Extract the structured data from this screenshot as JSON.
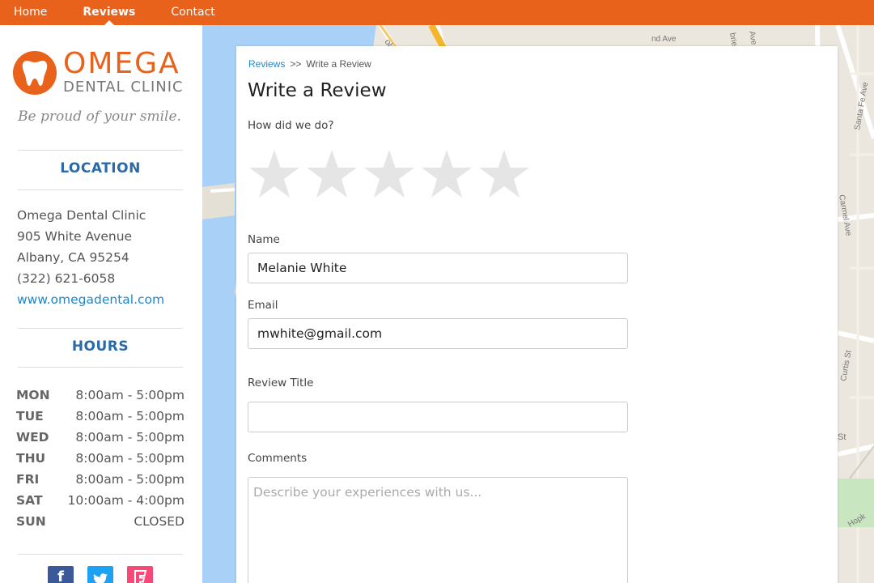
{
  "nav": {
    "items": [
      {
        "label": "Home",
        "active": false
      },
      {
        "label": "Reviews",
        "active": true
      },
      {
        "label": "Contact",
        "active": false
      }
    ]
  },
  "brand": {
    "name": "OMEGA",
    "subname": "DENTAL CLINIC",
    "tagline": "Be proud of your smile.",
    "accent_color": "#e8621c"
  },
  "location": {
    "title": "LOCATION",
    "name": "Omega Dental Clinic",
    "street": "905 White Avenue",
    "city": "Albany, CA 95254",
    "phone": "(322) 621-6058",
    "website": "www.omegadental.com"
  },
  "hours": {
    "title": "HOURS",
    "rows": [
      {
        "day": "MON",
        "time": "8:00am - 5:00pm"
      },
      {
        "day": "TUE",
        "time": "8:00am - 5:00pm"
      },
      {
        "day": "WED",
        "time": "8:00am - 5:00pm"
      },
      {
        "day": "THU",
        "time": "8:00am - 5:00pm"
      },
      {
        "day": "FRI",
        "time": "8:00am - 5:00pm"
      },
      {
        "day": "SAT",
        "time": "10:00am - 4:00pm"
      },
      {
        "day": "SUN",
        "time": "CLOSED"
      }
    ]
  },
  "social": [
    {
      "icon": "facebook-icon",
      "glyph": "f",
      "color": "#3b5998"
    },
    {
      "icon": "twitter-icon",
      "glyph": "t",
      "color": "#1da1f2"
    },
    {
      "icon": "foursquare-icon",
      "glyph": "F",
      "color": "#f94877"
    }
  ],
  "map": {
    "streets": [
      "Gilbert St",
      "Santa Fe Ave",
      "Carmel Ave",
      "Curtis St",
      "Hopkins"
    ]
  },
  "review": {
    "breadcrumb": {
      "root": "Reviews",
      "separator": ">>",
      "current": "Write a Review"
    },
    "title": "Write a Review",
    "rating_label": "How did we do?",
    "rating_value": 0,
    "rating_max": 5,
    "name_label": "Name",
    "name_value": "Melanie White",
    "email_label": "Email",
    "email_value": "mwhite@gmail.com",
    "review_title_label": "Review Title",
    "review_title_value": "",
    "comments_label": "Comments",
    "comments_value": "",
    "comments_placeholder": "Describe your experiences with us..."
  }
}
